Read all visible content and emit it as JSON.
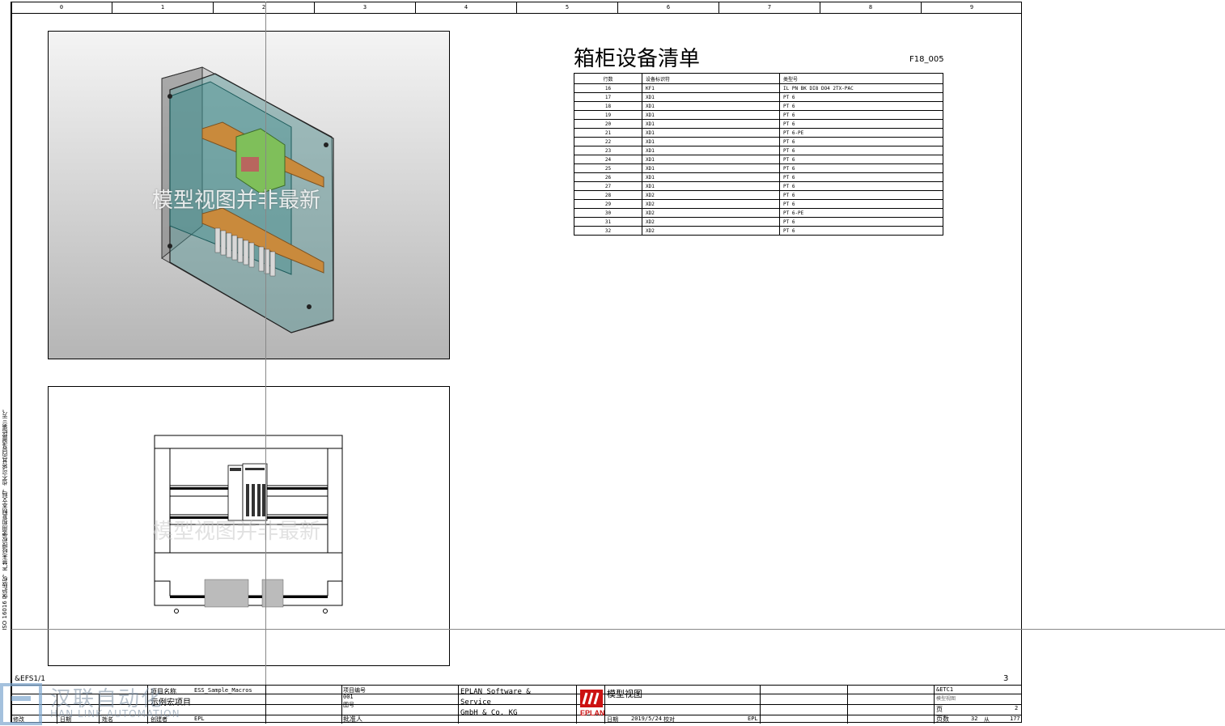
{
  "columns": [
    "0",
    "1",
    "2",
    "3",
    "4",
    "5",
    "6",
    "7",
    "8",
    "9"
  ],
  "left_strip_text": "ISO 16016 保护版权，严禁未经授权使用和复制本文档，也不可将其内容透露给第三方。",
  "viewport_3d": {
    "watermark": "模型视图并非最新"
  },
  "viewport_front": {
    "watermark": "模型视图并非最新"
  },
  "parts_list": {
    "title": "箱柜设备清单",
    "code": "F18_005",
    "headers": [
      "行数",
      "设备标识符",
      "类型号"
    ],
    "rows": [
      [
        "16",
        "KF1",
        "IL PN BK DI8 DO4 2TX-PAC"
      ],
      [
        "17",
        "XD1",
        "PT 6"
      ],
      [
        "18",
        "XD1",
        "PT 6"
      ],
      [
        "19",
        "XD1",
        "PT 6"
      ],
      [
        "20",
        "XD1",
        "PT 6"
      ],
      [
        "21",
        "XD1",
        "PT 6-PE"
      ],
      [
        "22",
        "XD1",
        "PT 6"
      ],
      [
        "23",
        "XD1",
        "PT 6"
      ],
      [
        "24",
        "XD1",
        "PT 6"
      ],
      [
        "25",
        "XD1",
        "PT 6"
      ],
      [
        "26",
        "XD1",
        "PT 6"
      ],
      [
        "27",
        "XD1",
        "PT 6"
      ],
      [
        "28",
        "XD2",
        "PT 6"
      ],
      [
        "29",
        "XD2",
        "PT 6"
      ],
      [
        "30",
        "XD2",
        "PT 6-PE"
      ],
      [
        "31",
        "XD2",
        "PT 6"
      ],
      [
        "32",
        "XD2",
        "PT 6"
      ]
    ]
  },
  "sheet_tag": "&EFS1/1",
  "page_number": "3",
  "watermark_brand": {
    "cn": "汉联自动化",
    "en": "HAN LINK AUTOMATION"
  },
  "title_block": {
    "project_name_label": "项目名称",
    "project_name": "ESS_Sample_Macros",
    "project_desc": "示例宏项目",
    "creator_label": "创建者",
    "creator": "EPL",
    "date_label": "日期",
    "edit_label": "修改",
    "name_label": "姓名",
    "project_no_label": "项目编号",
    "project_no": "001",
    "drawing_no_label": "图号",
    "approver_label": "批准人",
    "company": [
      "EPLAN Software &",
      "Service",
      "GmbH & Co. KG"
    ],
    "page_title": "模型视图",
    "date_label2": "日期",
    "date_value": "2019/5/24",
    "check_label": "校对",
    "check_value": "EPL",
    "location": "&ETC1",
    "location_sub": "模型视图",
    "page_label": "页",
    "page_value": "2",
    "total_label": "页数",
    "total_value": "32",
    "from_label": "从",
    "from_value": "177"
  },
  "colors": {
    "frame": "#000000",
    "cabinet_glass": "#3a8f8f",
    "rail": "#c98a3c",
    "plc": "#7fbf5a",
    "eplan_red": "#cc1111"
  }
}
